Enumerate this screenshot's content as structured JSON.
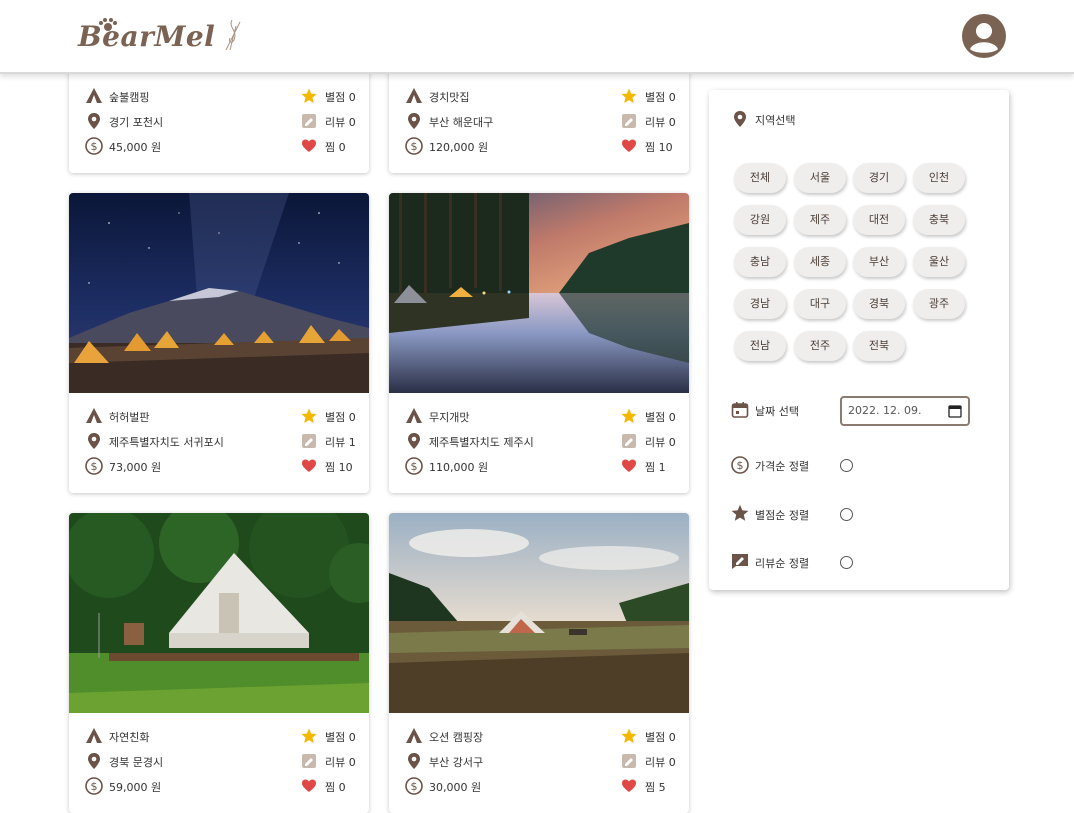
{
  "header": {
    "logo": "BearMel"
  },
  "cards": [
    {
      "name": "숲불캠핑",
      "location": "경기 포천시",
      "price": "45,000 원",
      "rating": "별점 0",
      "reviews": "리뷰 0",
      "likes": "찜 0"
    },
    {
      "name": "경치맛집",
      "location": "부산 해운대구",
      "price": "120,000 원",
      "rating": "별점 0",
      "reviews": "리뷰 0",
      "likes": "찜 10"
    },
    {
      "name": "허허벌판",
      "location": "제주특별자치도 서귀포시",
      "price": "73,000 원",
      "rating": "별점 0",
      "reviews": "리뷰 1",
      "likes": "찜 10"
    },
    {
      "name": "무지개맛",
      "location": "제주특별자치도 제주시",
      "price": "110,000 원",
      "rating": "별점 0",
      "reviews": "리뷰 0",
      "likes": "찜 1"
    },
    {
      "name": "자연친화",
      "location": "경북 문경시",
      "price": "59,000 원",
      "rating": "별점 0",
      "reviews": "리뷰 0",
      "likes": "찜 0"
    },
    {
      "name": "오션 캠핑장",
      "location": "부산 강서구",
      "price": "30,000 원",
      "rating": "별점 0",
      "reviews": "리뷰 0",
      "likes": "찜 5"
    }
  ],
  "filter": {
    "region_label": "지역선택",
    "regions": [
      "전체",
      "서울",
      "경기",
      "인천",
      "강원",
      "제주",
      "대전",
      "충북",
      "충남",
      "세종",
      "부산",
      "울산",
      "경남",
      "대구",
      "경북",
      "광주",
      "전남",
      "전주",
      "전북"
    ],
    "date_label": "날짜 선택",
    "date_value": "2022. 12. 09.",
    "sort_price": "가격순 정렬",
    "sort_rating": "별점순 정렬",
    "sort_review": "리뷰순 정렬"
  },
  "colors": {
    "brand": "#7b6353",
    "star": "#f5b800",
    "heart": "#e04848",
    "icon": "#6b5347"
  }
}
